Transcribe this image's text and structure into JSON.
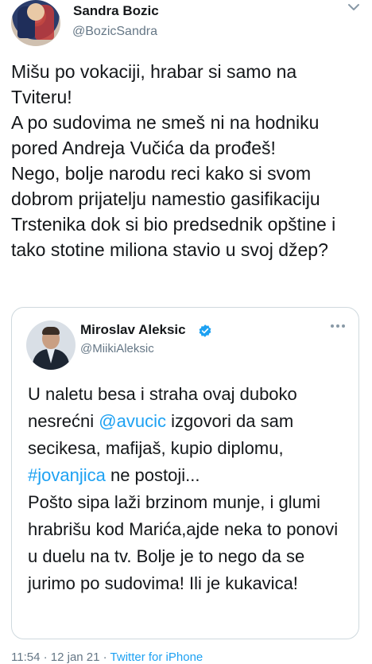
{
  "tweet": {
    "author_name": "Sandra Bozic",
    "author_handle": "@BozicSandra",
    "text": "Mišu po vokaciji, hrabar si samo na Tviteru!\nA po sudovima ne smeš ni na hodniku pored Andreja Vučića da prođeš!\nNego, bolje narodu reci kako si svom dobrom prijatelju namestio gasifikaciju Trstenika dok si bio predsednik opštine i tako stotine miliona stavio u svoj džep?"
  },
  "quoted_tweet": {
    "author_name": "Miroslav Aleksic",
    "author_handle": "@MiikiAleksic",
    "verified": true,
    "text_part1": "U naletu besa i straha ovaj duboko nesrećni ",
    "mention": "@avucic",
    "text_part2": " izgovori da sam secikesa, mafijaš, kupio diplomu, ",
    "hashtag": "#jovanjica",
    "text_part3": " ne postoji...\nPošto sipa laži brzinom munje, i glumi hrabrišu kod Marića,ajde neka to ponovi u duelu na tv. Bolje je to nego da se jurimo po sudovima! Ili je kukavica!"
  },
  "footer": {
    "time_date": "11:54 · 12 jan 21 · ",
    "source": "Twitter for iPhone"
  },
  "colors": {
    "link": "#1da1f2",
    "secondary_text": "#657786",
    "border": "#cfd9de"
  },
  "icons": [
    "chevron-down-icon",
    "verified-badge-icon",
    "more-icon"
  ]
}
